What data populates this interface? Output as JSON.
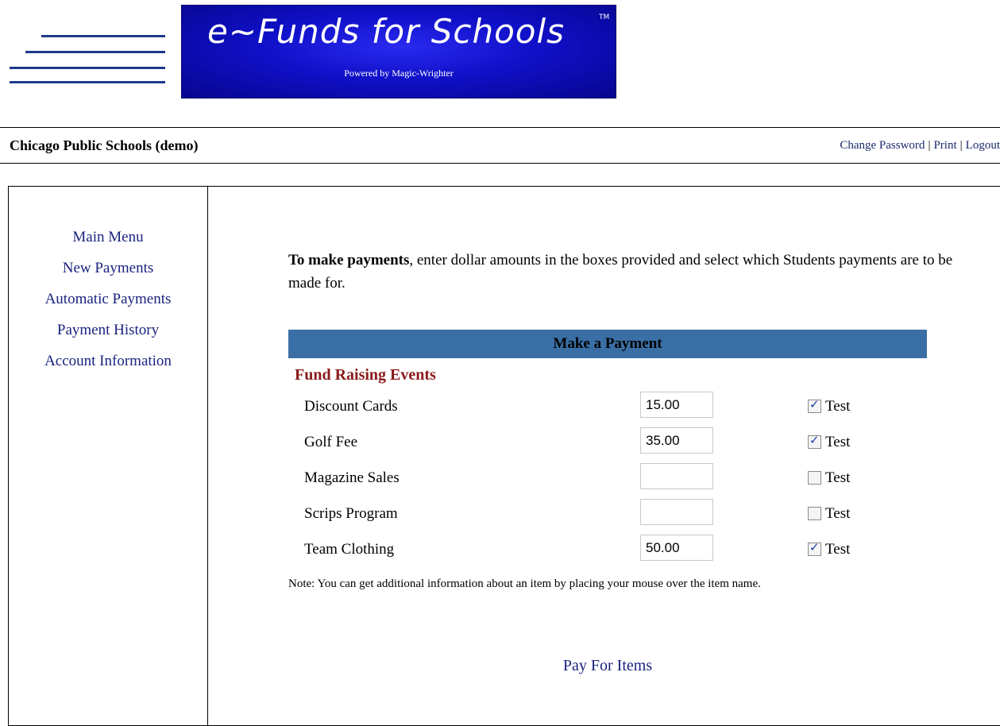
{
  "banner": {
    "brand": "e~Funds for Schools",
    "tm": "TM",
    "powered_by": "Powered by Magic-Wrighter"
  },
  "header": {
    "school_name": "Chicago Public Schools (demo)",
    "links": {
      "change_password": "Change Password",
      "print": "Print",
      "logout": "Logout",
      "separator": "|"
    }
  },
  "sidebar": {
    "items": [
      {
        "label": "Main Menu"
      },
      {
        "label": "New Payments"
      },
      {
        "label": "Automatic Payments"
      },
      {
        "label": "Payment History"
      },
      {
        "label": "Account Information"
      }
    ]
  },
  "main": {
    "intro_bold": "To make payments",
    "intro_rest": ", enter dollar amounts in the boxes provided and select which Students payments are to be made for.",
    "panel_title": "Make a Payment",
    "section_title": "Fund Raising Events",
    "items": [
      {
        "name": "Discount Cards",
        "amount": "15.00",
        "checked": true,
        "student": "Test"
      },
      {
        "name": "Golf Fee",
        "amount": "35.00",
        "checked": true,
        "student": "Test"
      },
      {
        "name": "Magazine Sales",
        "amount": "",
        "checked": false,
        "student": "Test"
      },
      {
        "name": "Scrips Program",
        "amount": "",
        "checked": false,
        "student": "Test"
      },
      {
        "name": "Team Clothing",
        "amount": "50.00",
        "checked": true,
        "student": "Test"
      }
    ],
    "note": "Note: You can get additional information about an item by placing your mouse over the item name.",
    "pay_button": "Pay For Items"
  },
  "colors": {
    "panel_header": "#3a6fa5",
    "section_title": "#8b1a1a",
    "link": "#1a237e",
    "banner": "#1010c8"
  }
}
